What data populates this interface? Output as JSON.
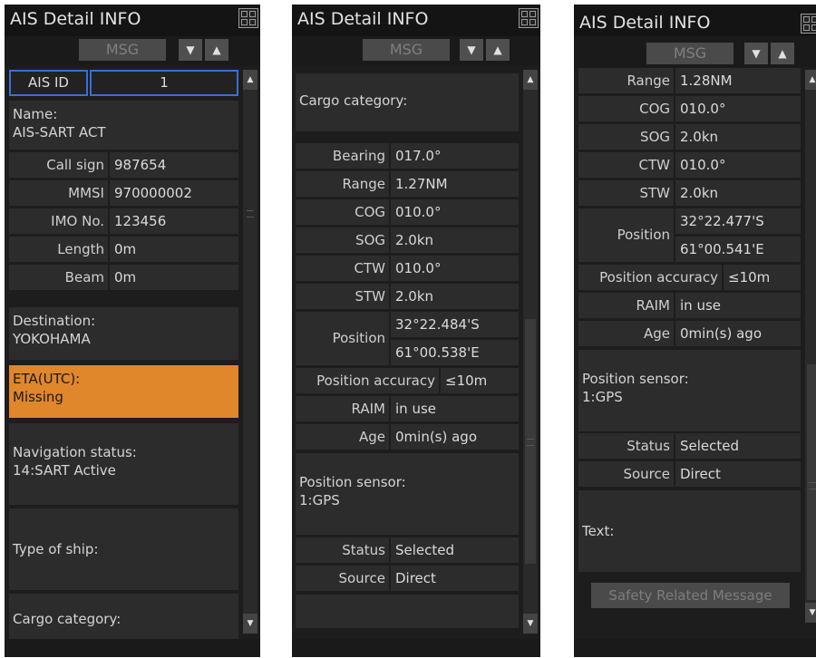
{
  "title": "AIS Detail INFO",
  "msg_label": "MSG",
  "arrow_down": "▼",
  "arrow_up": "▲",
  "sb_up": "▲",
  "sb_down": "▼",
  "panel1": {
    "ais_id_label": "AIS ID",
    "ais_id_value": "1",
    "name_label": "Name:",
    "name_value": "AIS-SART ACT",
    "call_sign_label": "Call sign",
    "call_sign_value": "987654",
    "mmsi_label": "MMSI",
    "mmsi_value": "970000002",
    "imo_label": "IMO No.",
    "imo_value": "123456",
    "length_label": "Length",
    "length_value": "0m",
    "beam_label": "Beam",
    "beam_value": "0m",
    "destination_label": "Destination:",
    "destination_value": "YOKOHAMA",
    "eta_label": "ETA(UTC):",
    "eta_value": "Missing",
    "nav_status_label": "Navigation status:",
    "nav_status_value": "14:SART Active",
    "type_label": "Type of ship:",
    "cargo_label": "Cargo category:"
  },
  "panel2": {
    "cargo_label": "Cargo category:",
    "bearing_label": "Bearing",
    "bearing_value": "017.0°",
    "range_label": "Range",
    "range_value": "1.27NM",
    "cog_label": "COG",
    "cog_value": "010.0°",
    "sog_label": "SOG",
    "sog_value": "2.0kn",
    "ctw_label": "CTW",
    "ctw_value": "010.0°",
    "stw_label": "STW",
    "stw_value": "2.0kn",
    "position_label": "Position",
    "lat_value": "32°22.484'S",
    "lon_value": "61°00.538'E",
    "pos_acc_label": "Position accuracy",
    "pos_acc_value": "≤10m",
    "raim_label": "RAIM",
    "raim_value": "in use",
    "age_label": "Age",
    "age_value": "0min(s) ago",
    "sensor_label": "Position sensor:",
    "sensor_value": "1:GPS",
    "status_label": "Status",
    "status_value": "Selected",
    "source_label": "Source",
    "source_value": "Direct"
  },
  "panel3": {
    "range_label": "Range",
    "range_value": "1.28NM",
    "cog_label": "COG",
    "cog_value": "010.0°",
    "sog_label": "SOG",
    "sog_value": "2.0kn",
    "ctw_label": "CTW",
    "ctw_value": "010.0°",
    "stw_label": "STW",
    "stw_value": "2.0kn",
    "position_label": "Position",
    "lat_value": "32°22.477'S",
    "lon_value": "61°00.541'E",
    "pos_acc_label": "Position accuracy",
    "pos_acc_value": "≤10m",
    "raim_label": "RAIM",
    "raim_value": "in use",
    "age_label": "Age",
    "age_value": "0min(s) ago",
    "sensor_label": "Position sensor:",
    "sensor_value": "1:GPS",
    "status_label": "Status",
    "status_value": "Selected",
    "source_label": "Source",
    "source_value": "Direct",
    "text_label": "Text:",
    "safety_button": "Safety Related Message"
  },
  "colors": {
    "panel_bg": "#1a1a1a",
    "cell_bg": "#2c2c2c",
    "alert": "#e0862b",
    "id_border": "#3a6fd4"
  }
}
